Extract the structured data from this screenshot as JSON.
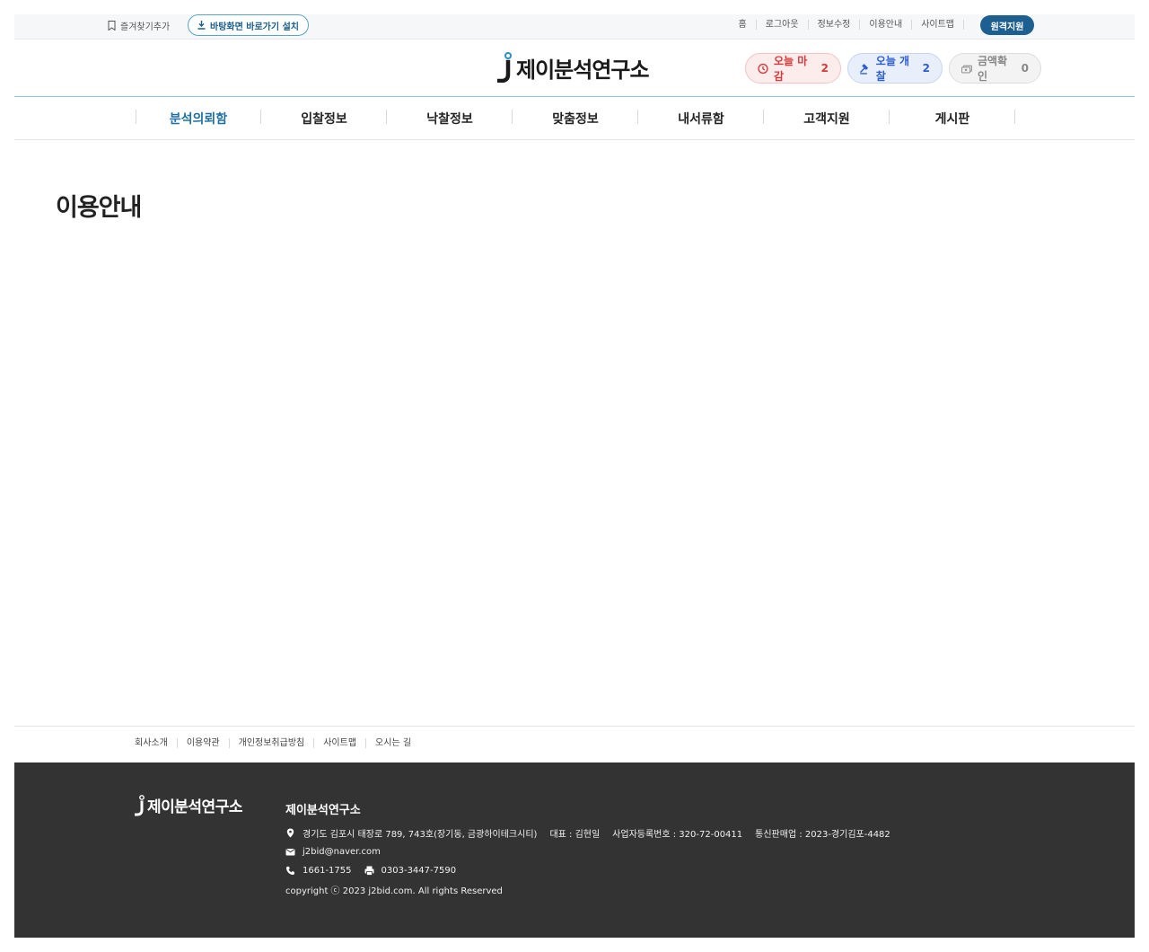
{
  "topbar": {
    "bookmark_label": "즐겨찾기추가",
    "install_label": "바탕화면 바로가기 설치",
    "links": [
      "홈",
      "로그아웃",
      "정보수정",
      "이용안내",
      "사이트맵"
    ],
    "remote_label": "원격지원"
  },
  "header": {
    "logo_text": "제이분석연구소",
    "pills": {
      "deadline": {
        "label": "오늘 마감",
        "count": "2",
        "color": "#d63a3a"
      },
      "open": {
        "label": "오늘 개찰",
        "count": "2",
        "color": "#2e5fd0"
      },
      "amount": {
        "label": "금액확인",
        "count": "0",
        "color": "#888888"
      }
    }
  },
  "nav": {
    "items": [
      "분석의뢰함",
      "입찰정보",
      "낙찰정보",
      "맞춤정보",
      "내서류함",
      "고객지원",
      "게시판"
    ],
    "active_index": 0,
    "accent": "#1d6fa3"
  },
  "main": {
    "page_title": "이용안내"
  },
  "footer_links": [
    "회사소개",
    "이용약관",
    "개인정보취급방침",
    "사이트맵",
    "오시는 길"
  ],
  "footer": {
    "logo_text": "제이분석연구소",
    "company": "제이분석연구소",
    "address": "경기도 김포시 태장로 789, 743호(장기동, 금광하이테크시티)",
    "ceo": "대표 : 김현일",
    "biz_no": "사업자등록번호 : 320-72-00411",
    "mail_order": "통신판매업 : 2023-경기김포-4482",
    "email": "j2bid@naver.com",
    "phone": "1661-1755",
    "fax": "0303-3447-7590",
    "copyright": "copyright ⓒ 2023 j2bid.com. All rights Reserved",
    "background": "#333333"
  }
}
